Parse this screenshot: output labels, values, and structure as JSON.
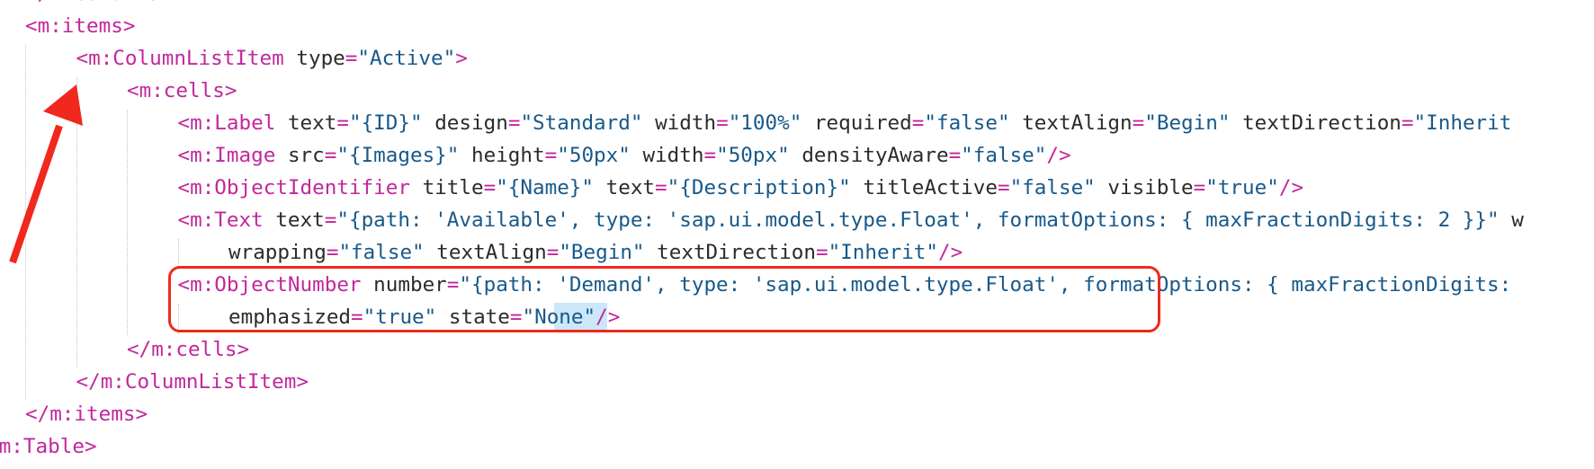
{
  "editor": {
    "lines": [
      {
        "level": 1,
        "text": "</m:columns>"
      },
      {
        "level": 1,
        "text": "<m:items>"
      },
      {
        "level": 2,
        "text": "<m:ColumnListItem type=\"Active\">"
      },
      {
        "level": 3,
        "text": "<m:cells>"
      },
      {
        "level": 4,
        "text": "<m:Label text=\"{ID}\" design=\"Standard\" width=\"100%\" required=\"false\" textAlign=\"Begin\" textDirection=\"Inherit"
      },
      {
        "level": 4,
        "text": "<m:Image src=\"{Images}\" height=\"50px\" width=\"50px\" densityAware=\"false\"/>"
      },
      {
        "level": 4,
        "text": "<m:ObjectIdentifier title=\"{Name}\" text=\"{Description}\" titleActive=\"false\" visible=\"true\"/>"
      },
      {
        "level": 4,
        "text": "<m:Text text=\"{path: 'Available', type: 'sap.ui.model.type.Float', formatOptions: { maxFractionDigits: 2 }}\" w"
      },
      {
        "level": 5,
        "text": "wrapping=\"false\" textAlign=\"Begin\" textDirection=\"Inherit\"/>"
      },
      {
        "level": 4,
        "text": "<m:ObjectNumber number=\"{path: 'Demand', type: 'sap.ui.model.type.Float', formatOptions: { maxFractionDigits:"
      },
      {
        "level": 5,
        "text": "emphasized=\"true\" state=\"None\"/>"
      },
      {
        "level": 3,
        "text": "</m:cells>"
      },
      {
        "level": 2,
        "text": "</m:ColumnListItem>"
      },
      {
        "level": 1,
        "text": "</m:items>"
      },
      {
        "level": 0,
        "text": "</m:Table>"
      }
    ],
    "selected_text": "None"
  },
  "annotations": {
    "highlight_color": "#f0281e",
    "arrow_icon": "red-arrow-icon",
    "box": "red-highlight-box"
  },
  "colors": {
    "tag": "#c2279c",
    "value": "#17598a",
    "attribute": "#2b2b2b",
    "selection": "#cce8f8"
  }
}
